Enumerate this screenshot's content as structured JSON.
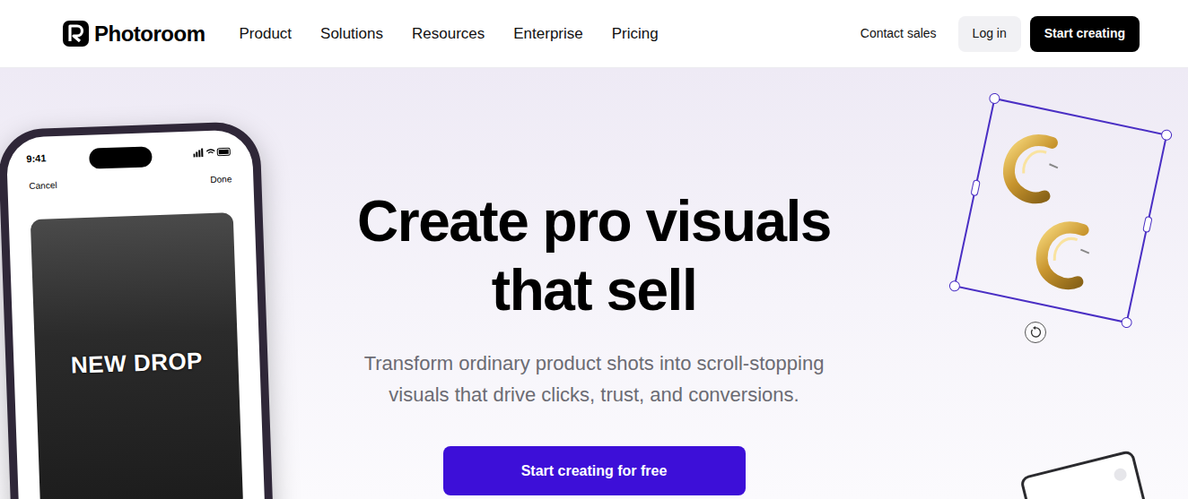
{
  "header": {
    "logo": "Photoroom",
    "nav": [
      "Product",
      "Solutions",
      "Resources",
      "Enterprise",
      "Pricing"
    ],
    "contact": "Contact sales",
    "login": "Log in",
    "cta": "Start creating"
  },
  "hero": {
    "title_lines": [
      "Create pro visuals",
      "that sell"
    ],
    "subtitle_lines": [
      "Transform ordinary product shots into scroll-stopping",
      "visuals that drive clicks, trust, and conversions."
    ],
    "cta": "Start creating for free"
  },
  "phone": {
    "time": "9:41",
    "cancel": "Cancel",
    "done": "Done",
    "overlay": "NEW DROP"
  }
}
